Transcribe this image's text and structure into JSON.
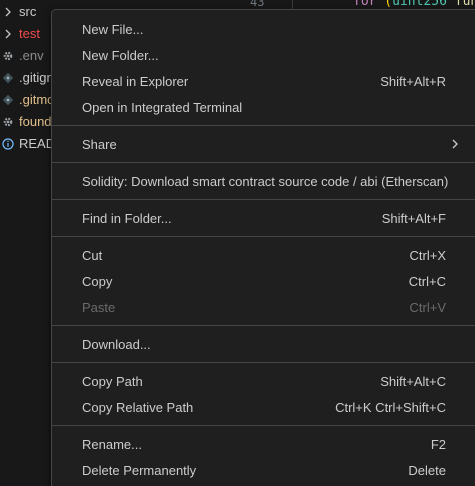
{
  "explorer": {
    "items": [
      {
        "label": "src",
        "kind": "folder",
        "color": "#cccccc"
      },
      {
        "label": "test",
        "kind": "folder",
        "color": "#f14c4c"
      },
      {
        "label": ".env",
        "kind": "gear",
        "color": "#8c8c8c"
      },
      {
        "label": ".gitign",
        "kind": "git",
        "color": "#cccccc"
      },
      {
        "label": ".gitmo",
        "kind": "git",
        "color": "#e2c08d"
      },
      {
        "label": "found",
        "kind": "gear",
        "color": "#e2c08d"
      },
      {
        "label": "READ",
        "kind": "info",
        "color": "#cccccc"
      }
    ]
  },
  "editor": {
    "line_number": "43",
    "code": {
      "kw": "for",
      "open": " (",
      "type": "uint256",
      "rest": " fun"
    }
  },
  "context_menu": {
    "groups": [
      [
        {
          "label": "New File...",
          "shortcut": ""
        },
        {
          "label": "New Folder...",
          "shortcut": ""
        },
        {
          "label": "Reveal in Explorer",
          "shortcut": "Shift+Alt+R"
        },
        {
          "label": "Open in Integrated Terminal",
          "shortcut": ""
        }
      ],
      [
        {
          "label": "Share",
          "shortcut": "",
          "submenu": true
        }
      ],
      [
        {
          "label": "Solidity: Download smart contract source code / abi (Etherscan)",
          "shortcut": ""
        }
      ],
      [
        {
          "label": "Find in Folder...",
          "shortcut": "Shift+Alt+F"
        }
      ],
      [
        {
          "label": "Cut",
          "shortcut": "Ctrl+X"
        },
        {
          "label": "Copy",
          "shortcut": "Ctrl+C"
        },
        {
          "label": "Paste",
          "shortcut": "Ctrl+V",
          "disabled": true
        }
      ],
      [
        {
          "label": "Download...",
          "shortcut": ""
        }
      ],
      [
        {
          "label": "Copy Path",
          "shortcut": "Shift+Alt+C"
        },
        {
          "label": "Copy Relative Path",
          "shortcut": "Ctrl+K Ctrl+Shift+C"
        }
      ],
      [
        {
          "label": "Rename...",
          "shortcut": "F2"
        },
        {
          "label": "Delete Permanently",
          "shortcut": "Delete"
        }
      ]
    ]
  }
}
